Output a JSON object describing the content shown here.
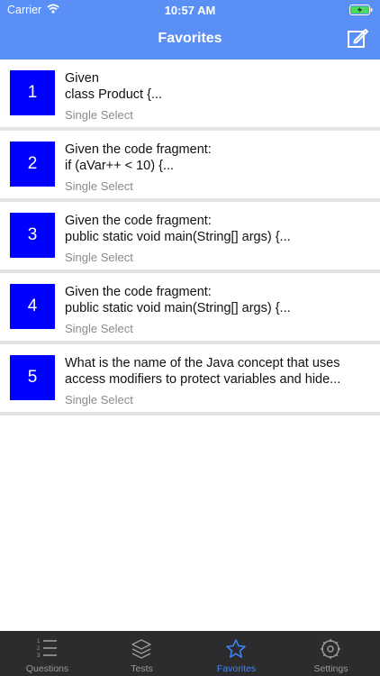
{
  "status": {
    "carrier": "Carrier",
    "time": "10:57 AM"
  },
  "header": {
    "title": "Favorites"
  },
  "items": [
    {
      "num": "1",
      "line1": "Given",
      "line2": "class Product {...",
      "type": "Single Select"
    },
    {
      "num": "2",
      "line1": "Given the code fragment:",
      "line2": "if (aVar++ < 10) {...",
      "type": "Single Select"
    },
    {
      "num": "3",
      "line1": "Given the code fragment:",
      "line2": "public static void main(String[] args) {...",
      "type": "Single Select"
    },
    {
      "num": "4",
      "line1": "Given the code fragment:",
      "line2": "public static void main(String[] args) {...",
      "type": "Single Select"
    },
    {
      "num": "5",
      "line1": "What is the name of the Java concept that uses",
      "line2": "access modifiers to protect variables and hide...",
      "type": "Single Select"
    }
  ],
  "tabs": [
    {
      "label": "Questions",
      "icon": "list-icon"
    },
    {
      "label": "Tests",
      "icon": "layers-icon"
    },
    {
      "label": "Favorites",
      "icon": "star-icon",
      "active": true
    },
    {
      "label": "Settings",
      "icon": "gear-icon"
    }
  ],
  "colors": {
    "header": "#5a8ff5",
    "badge": "#0000ff",
    "active_tab": "#3b86ff",
    "tabbar": "#2c2c2e"
  }
}
